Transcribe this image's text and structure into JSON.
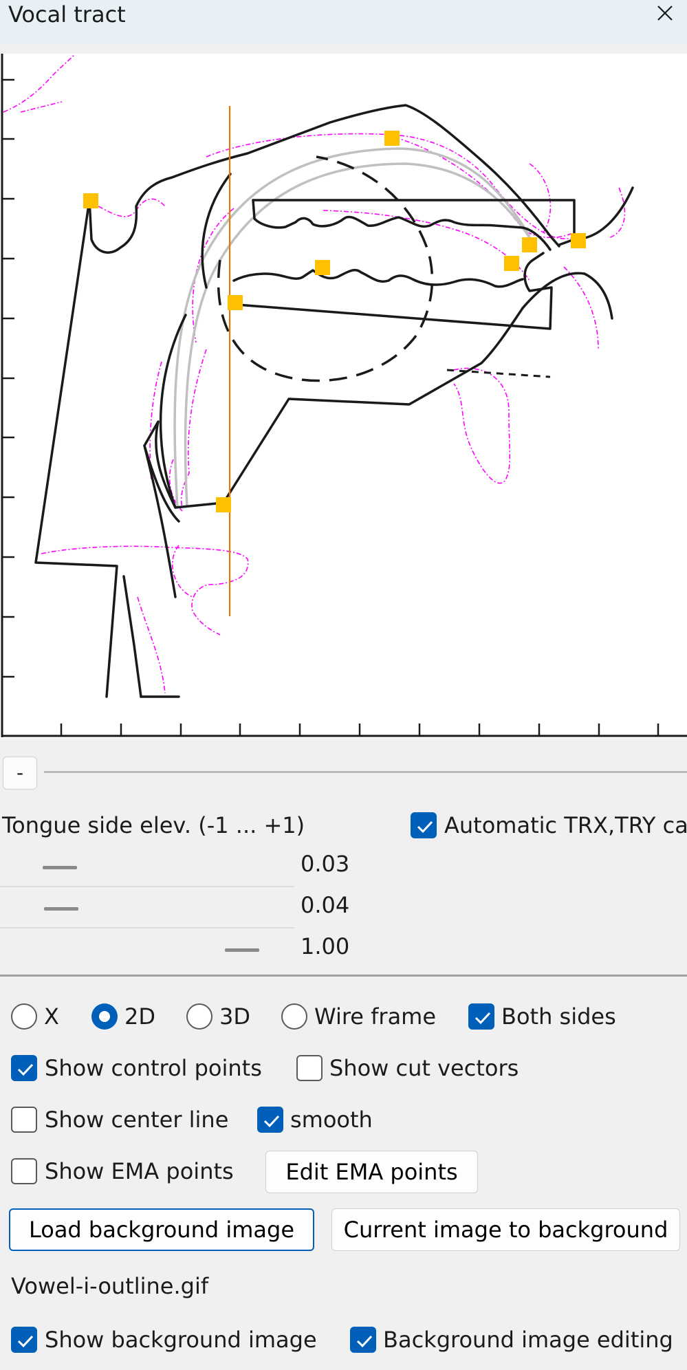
{
  "window": {
    "title": "Vocal tract"
  },
  "icons": {
    "close": "close-icon",
    "check": "checkmark-icon"
  },
  "colors": {
    "accent": "#005fb8",
    "control_point": "#ffc000",
    "contour": "#1a1a1a",
    "reference": "#ff00ff",
    "guide_line": "#e07a00"
  },
  "slider_section": {
    "minus_label": "-",
    "param_label": "Tongue side elev. (-1 ... +1)",
    "auto_checkbox": {
      "label": "Automatic TRX,TRY ca",
      "checked": true
    },
    "sliders": [
      {
        "value_label": "0.03",
        "level": 0.03
      },
      {
        "value_label": "0.04",
        "level": 0.04
      },
      {
        "value_label": "1.00",
        "level": 1.0
      }
    ]
  },
  "view_mode": {
    "options": [
      {
        "label": "X",
        "selected": false
      },
      {
        "label": "2D",
        "selected": true
      },
      {
        "label": "3D",
        "selected": false
      },
      {
        "label": "Wire frame",
        "selected": false
      }
    ]
  },
  "options": {
    "both_sides": {
      "label": "Both sides",
      "checked": true
    },
    "show_control_points": {
      "label": "Show control points",
      "checked": true
    },
    "show_cut_vectors": {
      "label": "Show cut vectors",
      "checked": false
    },
    "show_center_line": {
      "label": "Show center line",
      "checked": false
    },
    "smooth": {
      "label": "smooth",
      "checked": true
    },
    "show_ema_points": {
      "label": "Show EMA points",
      "checked": false
    },
    "show_background_image": {
      "label": "Show background image",
      "checked": true
    },
    "background_image_editing": {
      "label": "Background image editing",
      "checked": true
    }
  },
  "buttons": {
    "edit_ema": "Edit EMA points",
    "load_background": "Load background image",
    "current_to_background": "Current image to background"
  },
  "background_file": "Vowel-i-outline.gif"
}
